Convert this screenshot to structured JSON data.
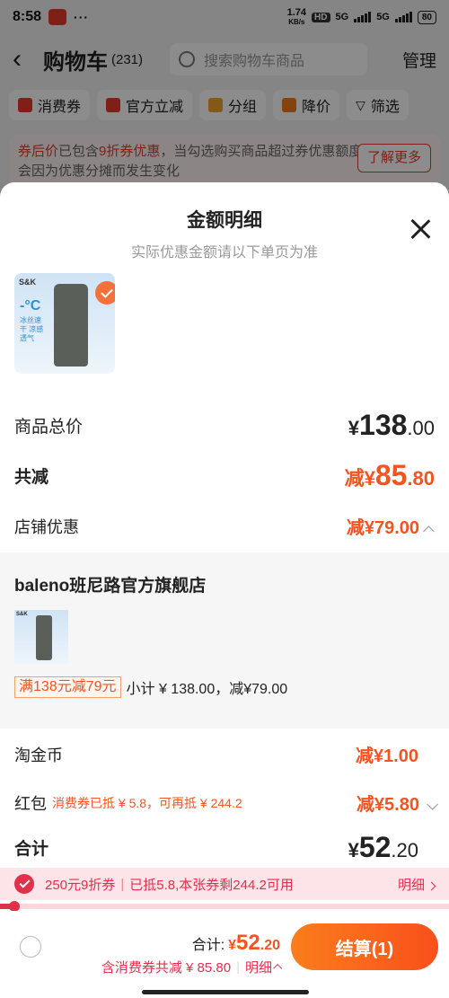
{
  "status_bar": {
    "time": "8:58",
    "dots": "···",
    "speed_num": "1.74",
    "speed_unit": "KB/s",
    "hd": "HD",
    "net1": "5G",
    "net2": "5G",
    "battery": "80"
  },
  "header": {
    "back": "‹",
    "title": "购物车",
    "count": "(231)",
    "search_placeholder": "搜索购物车商品",
    "manage": "管理"
  },
  "chips": [
    {
      "label": "消费券",
      "icon_color": "#e53b2c"
    },
    {
      "label": "官方立减",
      "icon_color": "#e53b2c"
    },
    {
      "label": "分组",
      "icon_color": "#f0a12a"
    },
    {
      "label": "降价",
      "icon_color": "#f07b1a"
    },
    {
      "label": "筛选",
      "icon_color": "#444"
    }
  ],
  "notice": {
    "t1": "券后价",
    "t2": "已包含",
    "t3": "9折券优惠",
    "t4": "，当勾选购买商品超过券优惠额度时，券后价会因为优惠分摊而发生变化",
    "more": "了解更多"
  },
  "sheet": {
    "title": "金额明细",
    "subtitle": "实际优惠金额请以下单页为准",
    "product_brand": "S&K",
    "product_temp": "-°C",
    "product_desc": "冰丝速干 凉感透气"
  },
  "rows": {
    "total_label": "商品总价",
    "total_cur": "¥",
    "total_int": "138",
    "total_dec": ".00",
    "reduce_label": "共减",
    "reduce_prefix": "减¥",
    "reduce_int": "85",
    "reduce_dec": ".80",
    "store_label": "店铺优惠",
    "store_val": "减¥79.00",
    "coin_label": "淘金币",
    "coin_val": "减¥1.00",
    "hongbao_label": "红包",
    "hongbao_tag": "消费券已抵 ¥ 5.8，可再抵 ¥ 244.2",
    "hongbao_val": "减¥5.80",
    "sum_label": "合计",
    "sum_cur": "¥",
    "sum_int": "52",
    "sum_dec": ".20"
  },
  "shop": {
    "name": "baleno班尼路官方旗舰店",
    "promo_tag": "满138元减79元",
    "subtotal": "小计 ¥ 138.00，减¥79.00"
  },
  "coupon_strip": {
    "name": "250元9折券",
    "info": "已抵5.8,本张券剩244.2可用",
    "detail": "明细",
    "progress": 0.023
  },
  "bottom": {
    "total_label": "合计:",
    "cur": "¥",
    "int": "52",
    "dec": ".20",
    "sub": "含消费券共减 ¥ 85.80",
    "detail": "明细",
    "pay": "结算(1)"
  },
  "colors": {
    "accent": "#f5531f",
    "coupon_red": "#e0304a"
  }
}
